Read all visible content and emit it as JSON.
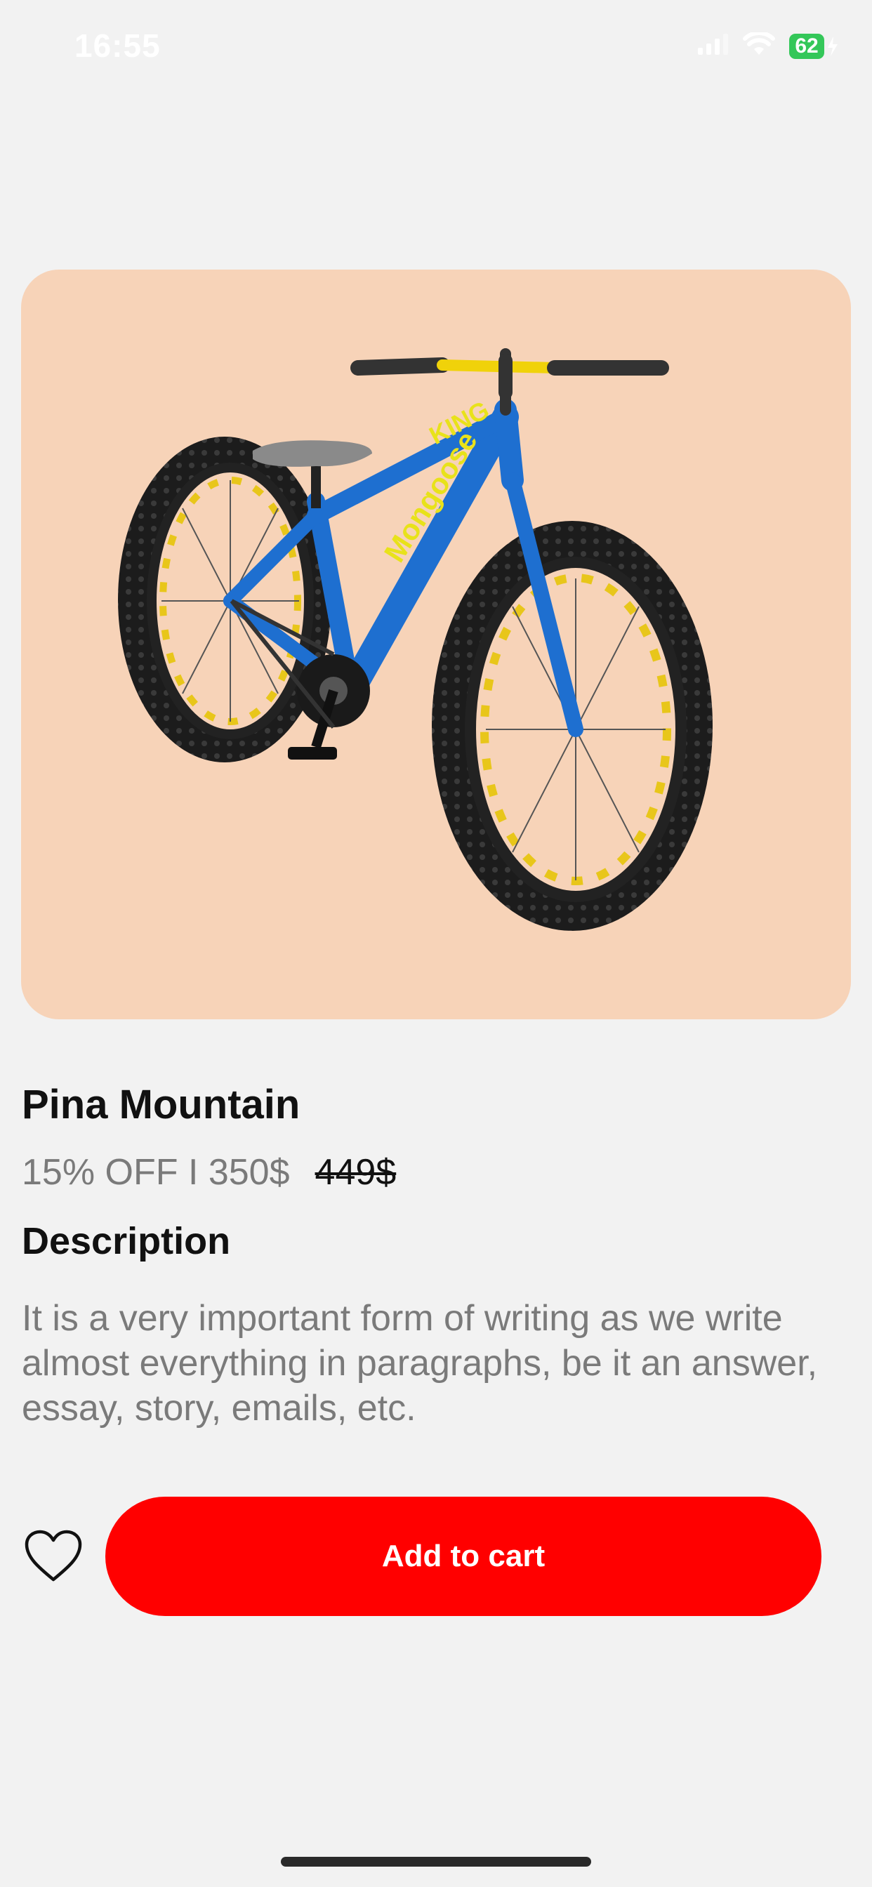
{
  "status_bar": {
    "time": "16:55",
    "battery": "62"
  },
  "product": {
    "image_alt": "blue fat tire bike",
    "title": "Pina Mountain",
    "price_info": "15% OFF I 350$",
    "old_price": "449$",
    "frame_text": "KING",
    "down_tube_text": "Mongoose",
    "description_heading": "Description",
    "description": "It is a very important form of writing as we write almost everything in paragraphs, be it an answer, essay, story, emails, etc."
  },
  "actions": {
    "add_to_cart_label": "Add to cart",
    "favorite_icon": "heart-outline-icon"
  },
  "colors": {
    "accent": "#ff0000",
    "image_background": "#f7d3b8",
    "page_background": "#f2f2f2",
    "bike_frame": "#1e6fd0",
    "battery": "#34c759"
  }
}
